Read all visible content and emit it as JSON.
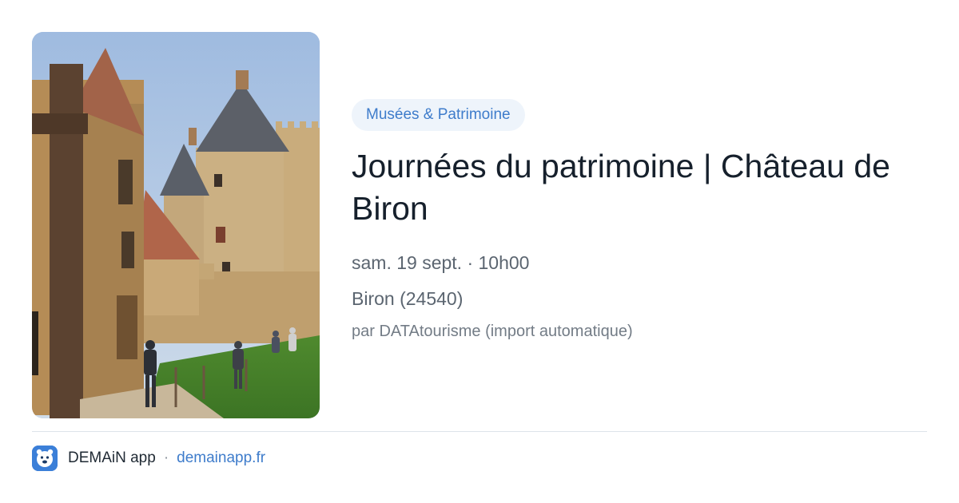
{
  "event": {
    "category": "Musées & Patrimoine",
    "title": "Journées du patrimoine | Château de Biron",
    "date": "sam. 19 sept. · 10h00",
    "location": "Biron (24540)",
    "source": "par DATAtourisme (import automatique)"
  },
  "image": {
    "icon": "castle-photo"
  },
  "footer": {
    "app_name": "DEMAiN app",
    "separator": "·",
    "site": "demainapp.fr",
    "icon": "demain-app-logo-icon"
  },
  "colors": {
    "accent": "#3e7ccb",
    "badge_bg": "#eef4fb",
    "title": "#16202c",
    "meta": "#5b6570",
    "app_icon": "#3b7fd8"
  }
}
